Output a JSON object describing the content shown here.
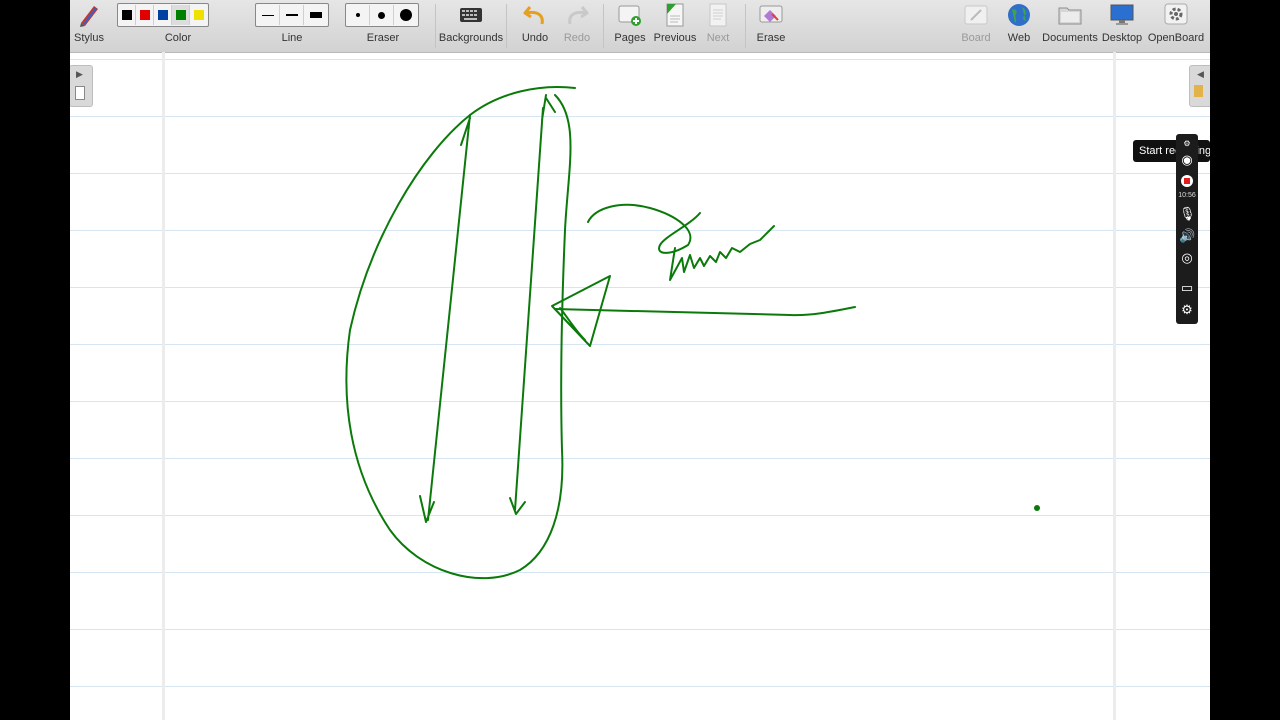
{
  "toolbar": {
    "stylus": "Stylus",
    "color": "Color",
    "line": "Line",
    "eraser": "Eraser",
    "backgrounds": "Backgrounds",
    "undo": "Undo",
    "redo": "Redo",
    "pages": "Pages",
    "previous": "Previous",
    "next": "Next",
    "erase": "Erase",
    "board": "Board",
    "web": "Web",
    "documents": "Documents",
    "desktop": "Desktop",
    "openboard": "OpenBoard"
  },
  "colors": {
    "palette": [
      "#000000",
      "#e00000",
      "#0040a0",
      "#008000",
      "#f0e000"
    ],
    "ink": "#0b7a0b",
    "rule_line": "#d5e6f2"
  },
  "recorder": {
    "tooltip": "Start recording",
    "timer": "10:56"
  }
}
